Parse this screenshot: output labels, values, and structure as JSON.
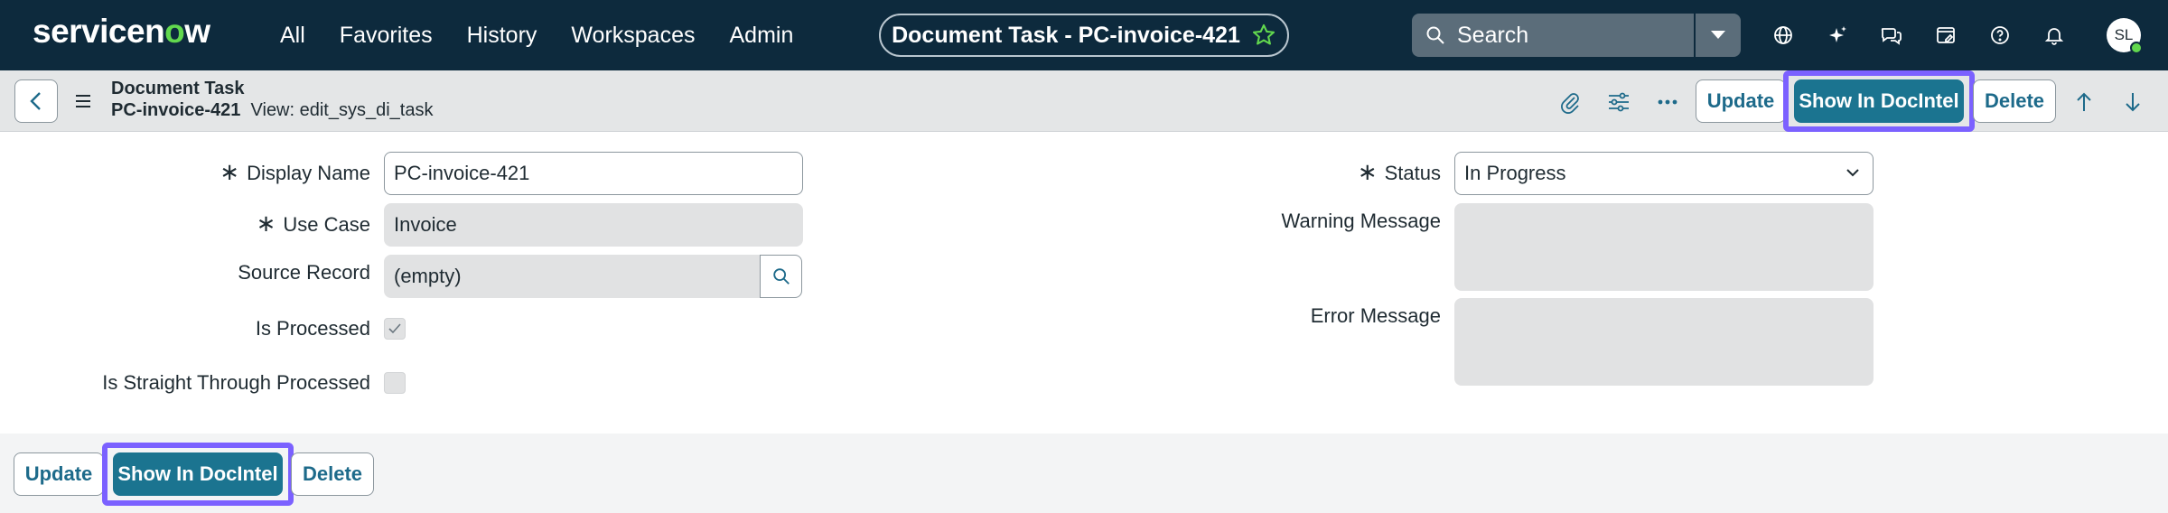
{
  "brand": {
    "logo_pre": "servicen",
    "logo_o": "o",
    "logo_post": "w"
  },
  "nav": {
    "items": [
      "All",
      "Favorites",
      "History",
      "Workspaces",
      "Admin"
    ]
  },
  "context": {
    "title": "Document Task - PC-invoice-421",
    "star_icon": "star-outline-icon",
    "star_color": "#62d84e"
  },
  "search": {
    "placeholder": "Search"
  },
  "nav_icons": [
    "globe-icon",
    "sparkle-icon",
    "chat-icon",
    "scratchpad-icon",
    "help-icon",
    "bell-icon"
  ],
  "user": {
    "initials": "SL",
    "status_color": "#62d84e"
  },
  "record": {
    "table_label": "Document Task",
    "number": "PC-invoice-421",
    "view_label": "View: edit_sys_di_task"
  },
  "actions": {
    "update": "Update",
    "show_in_docintel": "Show In DocIntel",
    "delete": "Delete"
  },
  "form": {
    "display_name": {
      "label": "Display Name",
      "value": "PC-invoice-421",
      "required": true
    },
    "use_case": {
      "label": "Use Case",
      "value": "Invoice",
      "required": true
    },
    "source_record": {
      "label": "Source Record",
      "value": "(empty)"
    },
    "is_processed": {
      "label": "Is Processed",
      "checked": true
    },
    "is_straight_through": {
      "label": "Is Straight Through Processed",
      "checked": false
    },
    "status": {
      "label": "Status",
      "value": "In Progress",
      "required": true
    },
    "warning_message": {
      "label": "Warning Message",
      "value": ""
    },
    "error_message": {
      "label": "Error Message",
      "value": ""
    }
  },
  "colors": {
    "nav_bg": "#0d2a3d",
    "primary": "#1b7490",
    "highlight": "#7b61ff",
    "link": "#1d6a8a"
  }
}
